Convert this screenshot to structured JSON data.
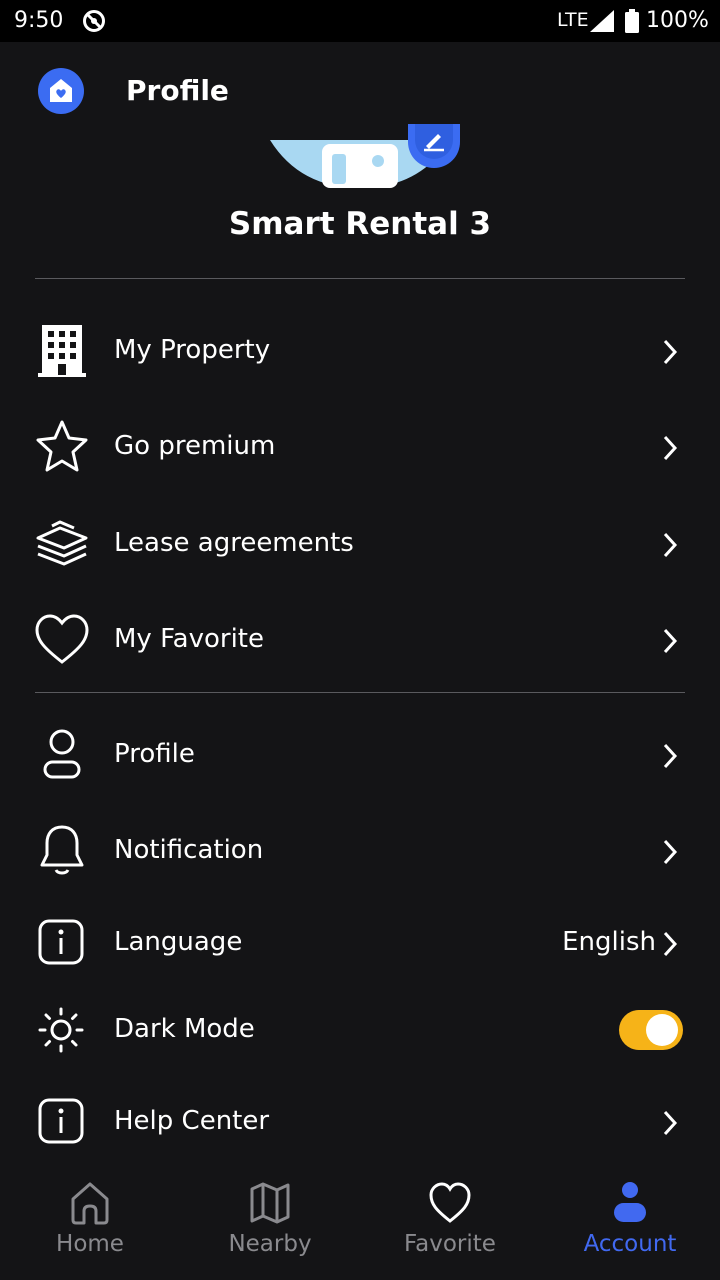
{
  "status_bar": {
    "time": "9:50",
    "network": "LTE",
    "battery": "100%"
  },
  "header": {
    "title": "Profile",
    "logo_icon": "home-heart-icon"
  },
  "profile": {
    "name": "Smart Rental 3"
  },
  "menu": {
    "my_property": {
      "label": "My Property",
      "icon": "building-icon"
    },
    "go_premium": {
      "label": "Go premium",
      "icon": "star-icon"
    },
    "lease_agreements": {
      "label": "Lease agreements",
      "icon": "documents-stack-icon"
    },
    "my_favorite": {
      "label": "My Favorite",
      "icon": "heart-icon"
    },
    "profile": {
      "label": "Profile",
      "icon": "user-icon"
    },
    "notification": {
      "label": "Notification",
      "icon": "bell-icon"
    },
    "language": {
      "label": "Language",
      "value": "English",
      "icon": "info-icon"
    },
    "dark_mode": {
      "label": "Dark Mode",
      "enabled": true,
      "icon": "sun-icon"
    },
    "help_center": {
      "label": "Help Center",
      "icon": "info-icon"
    }
  },
  "bottom_nav": {
    "home": {
      "label": "Home"
    },
    "nearby": {
      "label": "Nearby"
    },
    "favorite": {
      "label": "Favorite"
    },
    "account": {
      "label": "Account",
      "active": true
    }
  },
  "colors": {
    "background": "#141416",
    "accent": "#4169f0",
    "toggle_on": "#f6b318",
    "inactive": "#8a8a8e"
  }
}
